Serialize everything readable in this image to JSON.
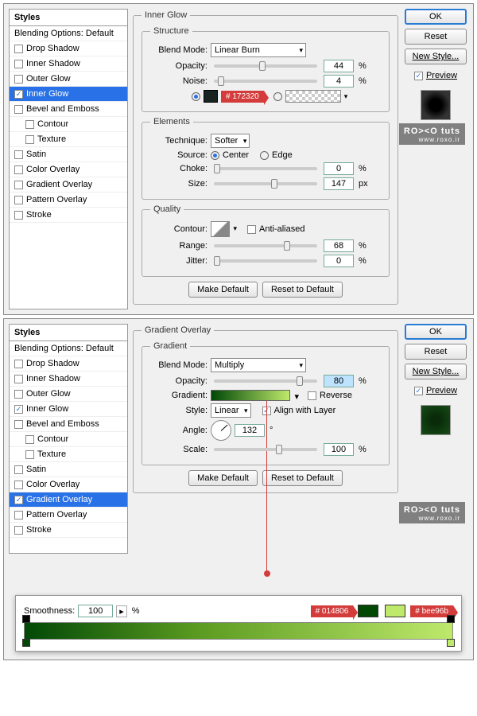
{
  "watermark": {
    "brand": "RO><O tuts",
    "url": "www.roxo.ir"
  },
  "buttons": {
    "ok": "OK",
    "reset": "Reset",
    "newstyle": "New Style...",
    "preview": "Preview",
    "makedefault": "Make Default",
    "resetdefault": "Reset to Default"
  },
  "styles_header": "Styles",
  "styles_list": [
    {
      "label": "Blending Options: Default",
      "chk": null
    },
    {
      "label": "Drop Shadow",
      "chk": false
    },
    {
      "label": "Inner Shadow",
      "chk": false
    },
    {
      "label": "Outer Glow",
      "chk": false
    },
    {
      "label": "Inner Glow",
      "chk": true
    },
    {
      "label": "Bevel and Emboss",
      "chk": false
    },
    {
      "label": "Contour",
      "chk": false,
      "indent": true
    },
    {
      "label": "Texture",
      "chk": false,
      "indent": true
    },
    {
      "label": "Satin",
      "chk": false
    },
    {
      "label": "Color Overlay",
      "chk": false
    },
    {
      "label": "Gradient Overlay",
      "chk": false
    },
    {
      "label": "Pattern Overlay",
      "chk": false
    },
    {
      "label": "Stroke",
      "chk": false
    }
  ],
  "panel1": {
    "title": "Inner Glow",
    "structure": {
      "legend": "Structure",
      "blendmode_lbl": "Blend Mode:",
      "blendmode": "Linear Burn",
      "opacity_lbl": "Opacity:",
      "opacity": "44",
      "opacity_unit": "%",
      "noise_lbl": "Noise:",
      "noise": "4",
      "noise_unit": "%",
      "color_hex": "# 172320"
    },
    "elements": {
      "legend": "Elements",
      "technique_lbl": "Technique:",
      "technique": "Softer",
      "source_lbl": "Source:",
      "center": "Center",
      "edge": "Edge",
      "choke_lbl": "Choke:",
      "choke": "0",
      "choke_unit": "%",
      "size_lbl": "Size:",
      "size": "147",
      "size_unit": "px"
    },
    "quality": {
      "legend": "Quality",
      "contour_lbl": "Contour:",
      "antialias": "Anti-aliased",
      "range_lbl": "Range:",
      "range": "68",
      "range_unit": "%",
      "jitter_lbl": "Jitter:",
      "jitter": "0",
      "jitter_unit": "%"
    }
  },
  "panel2": {
    "title": "Gradient Overlay",
    "selected_index": 10,
    "gradient": {
      "legend": "Gradient",
      "blendmode_lbl": "Blend Mode:",
      "blendmode": "Multiply",
      "opacity_lbl": "Opacity:",
      "opacity": "80",
      "opacity_unit": "%",
      "gradient_lbl": "Gradient:",
      "reverse": "Reverse",
      "style_lbl": "Style:",
      "style": "Linear",
      "align": "Align with Layer",
      "angle_lbl": "Angle:",
      "angle": "132",
      "angle_unit": "°",
      "scale_lbl": "Scale:",
      "scale": "100",
      "scale_unit": "%"
    },
    "editor": {
      "smoothness_lbl": "Smoothness:",
      "smoothness": "100",
      "smoothness_unit": "%",
      "hex1": "# 014806",
      "hex2": "# bee96b",
      "color1": "#014806",
      "color2": "#bee96b"
    }
  }
}
